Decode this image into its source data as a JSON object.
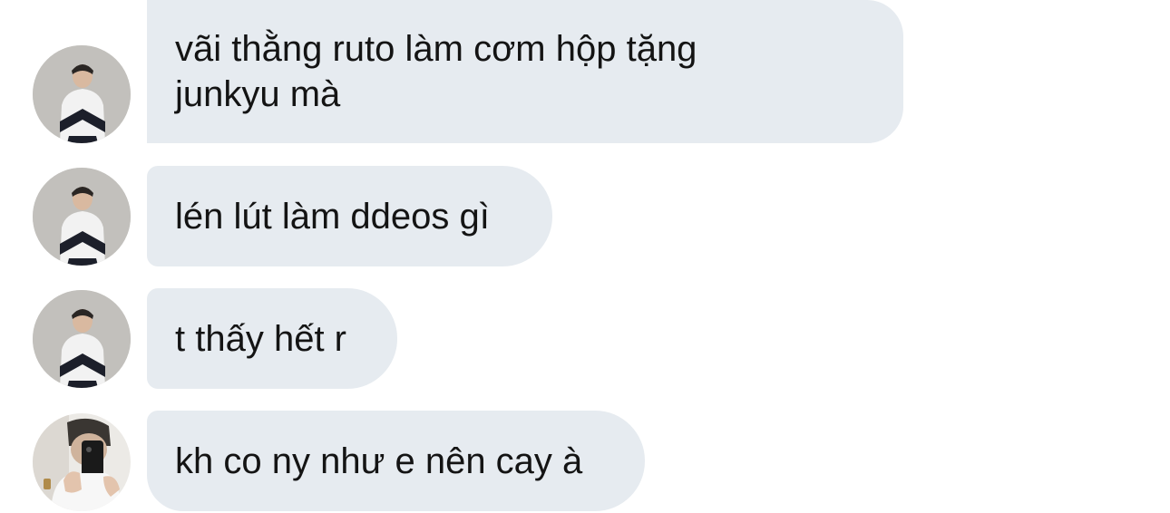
{
  "conversation": {
    "messages": [
      {
        "text": "vãi thằng ruto làm cơm hộp tặng junkyu mà",
        "avatar": "avatar-photo-person-striped-jacket"
      },
      {
        "text": "lén lút làm ddeos gì",
        "avatar": "avatar-photo-person-striped-jacket"
      },
      {
        "text": "t thấy hết r",
        "avatar": "avatar-photo-person-striped-jacket"
      },
      {
        "text": "kh co ny như e nên cay à",
        "avatar": "avatar-photo-mirror-selfie"
      }
    ]
  },
  "colors": {
    "bubble_bg": "#e6ebf0",
    "text": "#141414",
    "background": "#ffffff"
  }
}
